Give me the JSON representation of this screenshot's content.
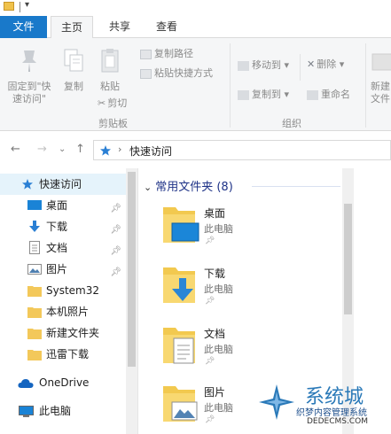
{
  "ribbon_tabs": [
    "文件",
    "主页",
    "共享",
    "查看"
  ],
  "ribbon": {
    "pin_quick_access": [
      "固定到\"快",
      "速访问\""
    ],
    "copy": "复制",
    "paste": "粘贴",
    "copy_path": "复制路径",
    "paste_shortcut": "粘贴快捷方式",
    "cut": "剪切",
    "clipboard_group": "剪贴板",
    "move_to": "移动到",
    "copy_to": "复制到",
    "delete": "删除",
    "rename": "重命名",
    "organize_group": "组织",
    "new_partial": [
      "新建",
      "文件"
    ]
  },
  "address": {
    "path": "快速访问",
    "back": "←",
    "forward": "→",
    "up": "↑",
    "recent": "⌄",
    "separator": "›"
  },
  "nav": {
    "quick_access": "快速访问",
    "items": [
      {
        "label": "桌面",
        "icon": "desktop-icon",
        "pinned": true
      },
      {
        "label": "下载",
        "icon": "download-icon",
        "pinned": true
      },
      {
        "label": "文档",
        "icon": "document-icon",
        "pinned": true
      },
      {
        "label": "图片",
        "icon": "picture-icon",
        "pinned": true
      },
      {
        "label": "System32",
        "icon": "folder-icon",
        "pinned": false
      },
      {
        "label": "本机照片",
        "icon": "folder-icon",
        "pinned": false
      },
      {
        "label": "新建文件夹",
        "icon": "folder-icon",
        "pinned": false
      },
      {
        "label": "迅雷下载",
        "icon": "folder-icon",
        "pinned": false
      }
    ],
    "onedrive": "OneDrive",
    "this_pc": "此电脑"
  },
  "content": {
    "group_title": "常用文件夹 (8)",
    "folders": [
      {
        "name": "桌面",
        "location": "此电脑",
        "icon": "desktop-folder-icon"
      },
      {
        "name": "下载",
        "location": "此电脑",
        "icon": "download-folder-icon"
      },
      {
        "name": "文档",
        "location": "此电脑",
        "icon": "document-folder-icon"
      },
      {
        "name": "图片",
        "location": "此电脑",
        "icon": "picture-folder-icon"
      }
    ]
  },
  "watermark": {
    "brand": "系统城",
    "cn_text": "织梦内容管理系统",
    "en_text": "DEDECMS.COM"
  },
  "colors": {
    "file_tab": "#1979ca",
    "selected": "#e5f3fb",
    "group_header": "#1e3287"
  }
}
